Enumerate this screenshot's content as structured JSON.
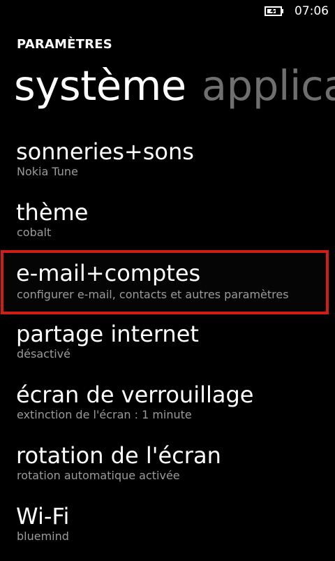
{
  "status_bar": {
    "time": "07:06",
    "battery_icon": "battery-charging-icon"
  },
  "header": {
    "app_title": "PARAMÈTRES"
  },
  "pivot": {
    "active": "système",
    "next": "applications"
  },
  "settings": [
    {
      "title": "sonneries+sons",
      "subtitle": "Nokia Tune"
    },
    {
      "title": "thème",
      "subtitle": "cobalt"
    },
    {
      "title": "e-mail+comptes",
      "subtitle": "configurer e-mail, contacts et autres paramètres",
      "highlighted": true
    },
    {
      "title": "partage internet",
      "subtitle": "désactivé"
    },
    {
      "title": "écran de verrouillage",
      "subtitle": "extinction de l'écran : 1 minute"
    },
    {
      "title": "rotation de l'écran",
      "subtitle": "rotation automatique activée"
    },
    {
      "title": "Wi-Fi",
      "subtitle": "bluemind"
    }
  ],
  "colors": {
    "background": "#000000",
    "text_primary": "#ffffff",
    "text_secondary": "#9b9b9b",
    "highlight_border": "#cf1e18",
    "inactive_pivot": "#6f6f6f"
  }
}
